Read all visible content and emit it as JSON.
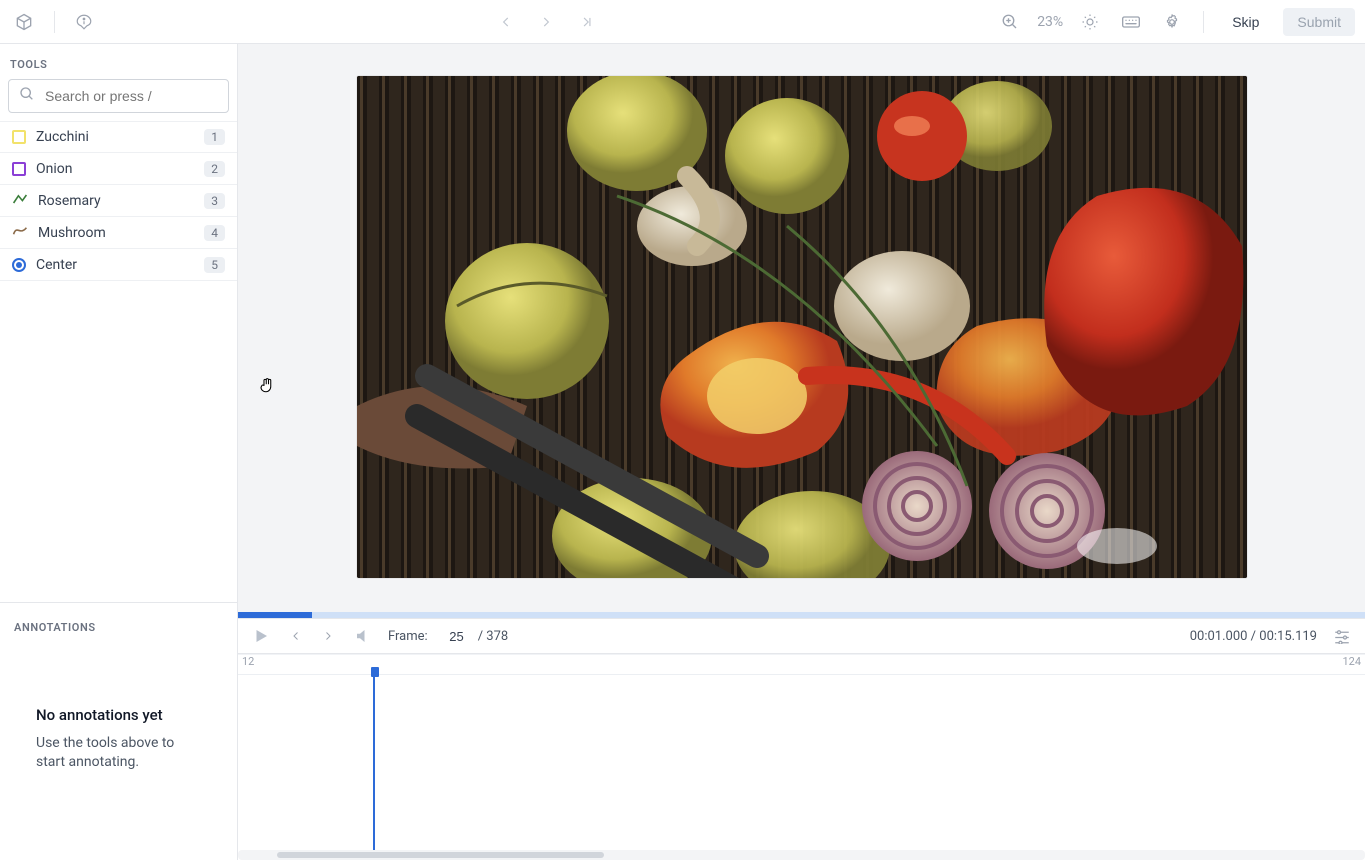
{
  "topbar": {
    "zoom_pct": "23%",
    "skip_label": "Skip",
    "submit_label": "Submit"
  },
  "sidebar": {
    "tools_label": "TOOLS",
    "search_placeholder": "Search or press /",
    "tools": [
      {
        "name": "Zucchini",
        "hotkey": "1",
        "kind": "box",
        "color": "#f2e26b"
      },
      {
        "name": "Onion",
        "hotkey": "2",
        "kind": "box",
        "color": "#8b3fd6"
      },
      {
        "name": "Rosemary",
        "hotkey": "3",
        "kind": "line",
        "color": "#3a7d3a"
      },
      {
        "name": "Mushroom",
        "hotkey": "4",
        "kind": "curve",
        "color": "#8b6b4a"
      },
      {
        "name": "Center",
        "hotkey": "5",
        "kind": "point",
        "color": "#2d6bd8"
      }
    ],
    "annotations_label": "ANNOTATIONS",
    "empty_title": "No annotations yet",
    "empty_sub": "Use the tools above to start annotating."
  },
  "playback": {
    "frame_label": "Frame:",
    "current_frame": "25",
    "total_frames_text": "/ 378",
    "time_text": "00:01.000 / 00:15.119",
    "ruler_start": "12",
    "ruler_end": "124",
    "progress_pct": 6.6,
    "playhead_pct": 12,
    "scroll_thumb_left_pct": 3.5,
    "scroll_thumb_width_pct": 29
  }
}
